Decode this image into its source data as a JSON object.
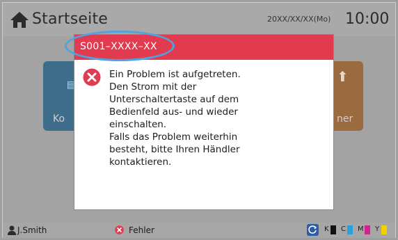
{
  "header": {
    "title": "Startseite",
    "date": "20XX/XX/XX(Mo)",
    "time": "10:00",
    "icon": "home-icon"
  },
  "background_tiles": [
    {
      "label": "Ko",
      "color": "#3d6d8b",
      "icon": "copy-icon"
    },
    {
      "label": "ner",
      "color": "#9b6a3f",
      "icon": "scan-upload-icon"
    }
  ],
  "dialog": {
    "error_code": "S001–XXXX–XX",
    "header_color": "#e23a4f",
    "highlight_color": "#4ea3e0",
    "icon": "error-x-icon",
    "message_lines": [
      "Ein Problem ist aufgetreten.",
      "Den Strom mit der",
      "Unterschaltertaste auf dem",
      "Bedienfeld aus- und wieder",
      "einschalten.",
      "Falls das Problem weiterhin",
      "besteht, bitte Ihren Händler",
      "kontaktieren."
    ]
  },
  "footer": {
    "user": "J.Smith",
    "status": "Fehler",
    "ink": [
      {
        "label": "K",
        "color": "#111111"
      },
      {
        "label": "C",
        "color": "#27a3d9"
      },
      {
        "label": "M",
        "color": "#d0248f"
      },
      {
        "label": "Y",
        "color": "#f0d000"
      }
    ]
  }
}
